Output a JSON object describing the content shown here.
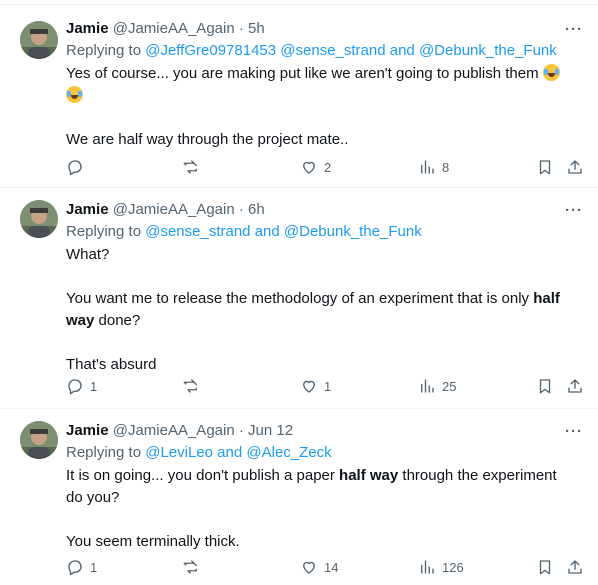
{
  "tweets": [
    {
      "name": "Jamie",
      "handle": "@JamieAA_Again",
      "time": "· 5h",
      "replying_prefix": "Replying to",
      "mentions": [
        "@JeffGre09781453",
        "@sense_strand",
        "@Debunk_the_Funk"
      ],
      "and": "and",
      "text_line1": "Yes of course... you are making put like we aren't going to publish them",
      "text_line2": "We are half way through the project mate..",
      "replies": "",
      "retweets": "",
      "likes": "2",
      "views": "8"
    },
    {
      "name": "Jamie",
      "handle": "@JamieAA_Again",
      "time": "· 6h",
      "replying_prefix": "Replying to",
      "mentions": [
        "@sense_strand",
        "@Debunk_the_Funk"
      ],
      "and": "and",
      "text_line1": "What?",
      "text_line2a": "You want me to release the methodology of an experiment that is only ",
      "text_bold": "half way",
      "text_line2b": " done?",
      "text_line3": "That's absurd",
      "replies": "1",
      "retweets": "",
      "likes": "1",
      "views": "25"
    },
    {
      "name": "Jamie",
      "handle": "@JamieAA_Again",
      "time": "· Jun 12",
      "replying_prefix": "Replying to",
      "mentions": [
        "@LeviLeo",
        "@Alec_Zeck"
      ],
      "and": "and",
      "text_line1a": "It is on going... you don't publish a paper ",
      "text_bold": "half way",
      "text_line1b": " through the experiment do you?",
      "text_line2": "You seem terminally thick.",
      "replies": "1",
      "retweets": "",
      "likes": "14",
      "views": "126"
    }
  ],
  "more_label": "···",
  "icons": [
    "reply-icon",
    "retweet-icon",
    "like-icon",
    "views-icon",
    "bookmark-icon",
    "share-icon"
  ],
  "colors": {
    "link": "#1d9bf0",
    "muted": "#536471",
    "text": "#0f1419",
    "divider": "#eff3f4"
  }
}
